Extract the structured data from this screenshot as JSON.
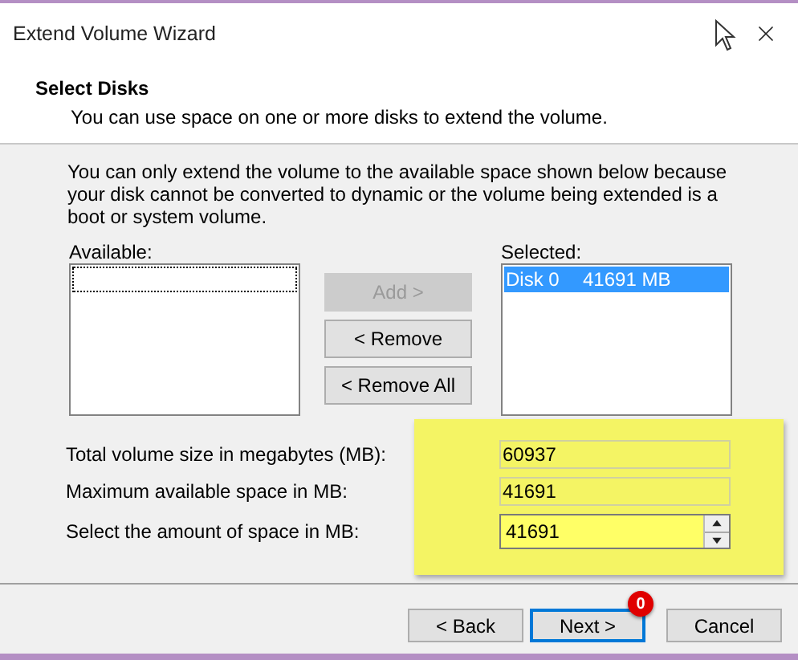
{
  "window": {
    "title": "Extend Volume Wizard"
  },
  "header": {
    "title": "Select Disks",
    "subtitle": "You can use space on one or more disks to extend the volume."
  },
  "description": "You can only extend the volume to the available space shown below because your disk cannot be converted to dynamic or the volume being extended is a boot or system volume.",
  "available": {
    "label": "Available:"
  },
  "move_buttons": [
    {
      "label": "Add >",
      "disabled": true
    },
    {
      "label": "< Remove",
      "disabled": false
    },
    {
      "label": "< Remove All",
      "disabled": false
    }
  ],
  "selected": {
    "label": "Selected:",
    "items": [
      {
        "disk": "Disk 0",
        "size": "41691 MB",
        "selected": true
      }
    ]
  },
  "size_fields": {
    "highlighted": true,
    "fields": [
      {
        "kind": "readonly",
        "label": "Total volume size in megabytes (MB):",
        "value": "60937"
      },
      {
        "kind": "readonly",
        "label": "Maximum available space in MB:",
        "value": "41691"
      },
      {
        "kind": "spin",
        "label": "Select the amount of space in MB:",
        "value": "41691"
      }
    ]
  },
  "footer_buttons": [
    {
      "label": "< Back",
      "default": false
    },
    {
      "label": "Next >",
      "default": true,
      "badge": "0"
    },
    {
      "label": "Cancel",
      "default": false
    }
  ]
}
